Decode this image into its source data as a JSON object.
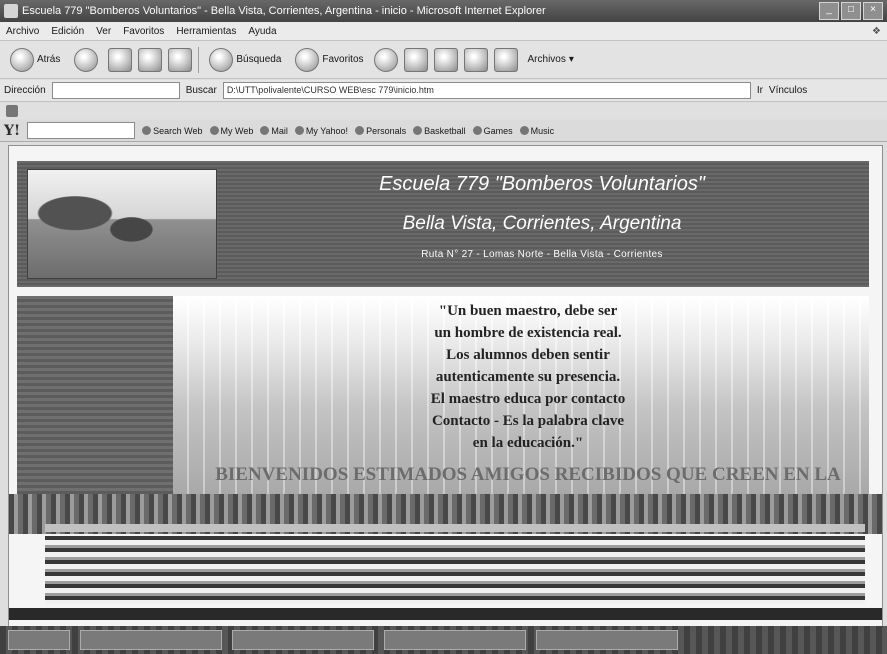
{
  "window": {
    "title": "Escuela 779 \"Bomberos Voluntarios\" - Bella Vista, Corrientes, Argentina - inicio - Microsoft Internet Explorer"
  },
  "menu": [
    "Archivo",
    "Edición",
    "Ver",
    "Favoritos",
    "Herramientas",
    "Ayuda"
  ],
  "toolbar": {
    "back": "Atrás",
    "search": "Búsqueda",
    "favorites": "Favoritos",
    "links": "Archivos"
  },
  "address": {
    "label": "Dirección",
    "search_btn": "Buscar",
    "url": "D:\\UTT\\polivalente\\CURSO WEB\\esc 779\\inicio.htm",
    "go": "Ir",
    "vinculos": "Vínculos"
  },
  "yahoo": {
    "search_web": "Search Web",
    "items": [
      "My Web",
      "Mail",
      "My Yahoo!",
      "Personals",
      "Basketball",
      "Games",
      "Music"
    ]
  },
  "page": {
    "title": "Escuela 779 \"Bomberos Voluntarios\"",
    "subtitle": "Bella Vista, Corrientes, Argentina",
    "address": "Ruta N° 27 - Lomas Norte - Bella Vista - Corrientes",
    "quote_lines": [
      "\"Un buen maestro, debe ser",
      "un hombre de existencia real.",
      "Los alumnos deben sentir",
      "autenticamente su presencia.",
      "El maestro educa por contacto",
      "Contacto - Es la palabra clave",
      "en la educación.\""
    ],
    "welcome_text": "BIENVENIDOS ESTIMADOS AMIGOS RECIBIDOS QUE CREEN EN LA"
  }
}
